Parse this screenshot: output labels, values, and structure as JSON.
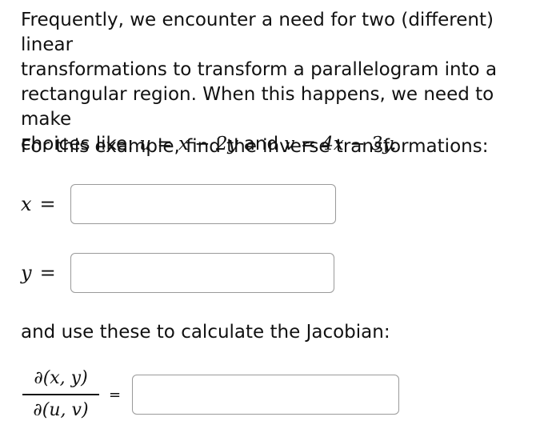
{
  "intro": {
    "line1": "Frequently, we encounter a need for two (different) linear",
    "line2": "transformations to transform a parallelogram into a",
    "line3": "rectangular region. When this happens, we need to make",
    "line4_prefix": "choices like:",
    "u_eq": "u = x − 2y",
    "and_word": "and",
    "v_eq": "v = 4x − 3y."
  },
  "prompt": "For this example, find the inverse transformations:",
  "x_row": {
    "var": "x",
    "eq": "=",
    "value": ""
  },
  "y_row": {
    "var": "y",
    "eq": "=",
    "value": ""
  },
  "jacobian_prompt": "and use these to calculate the Jacobian:",
  "jacobian": {
    "numerator": "∂(x, y)",
    "denominator": "∂(u, v)",
    "eq": "=",
    "value": ""
  }
}
